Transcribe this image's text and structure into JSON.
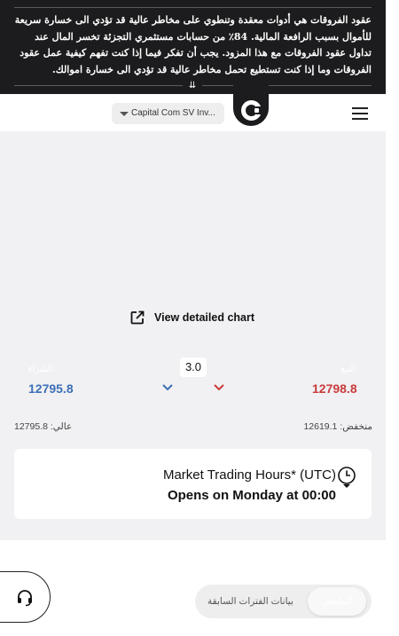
{
  "risk_banner": {
    "text": "عقود الفروقات هي أدوات معقدة وتنطوي على مخاطر عالية قد تؤدي الى خسارة سريعة للأموال بسبب الرافعة المالية. 84٪ من حسابات مستثمري التجزئة تخسر المال عند تداول عقود الفروقات مع هذا المزود. يجب أن تفكر فيما إذا كنت تفهم كيفية عمل عقود الفروقات وما إذا كنت تستطيع تحمل مخاطر عالية قد تؤدي الى خسارة اموالك.",
    "toggle_icon": "double-chevron-down"
  },
  "header": {
    "entity_selector": "Capital Com SV Inv...",
    "logo": "capital-com-logo",
    "menu_icon": "hamburger"
  },
  "chart": {
    "view_detailed_chart": "View detailed chart"
  },
  "quote": {
    "sell_label": "البيع",
    "sell_price": "12798.8",
    "buy_label": "الشراء",
    "buy_price": "12795.8",
    "spread": "3.0",
    "sell_color": "#c93b3b",
    "buy_color": "#3c6fb5"
  },
  "range": {
    "high": "عالي: 12795.8",
    "low": "منخفض: 12619.1"
  },
  "trading_hours": {
    "title": "Market Trading Hours* (UTC)",
    "status": "Opens on Monday at 00:00"
  },
  "bottom_tabs": {
    "summary": "الملخص",
    "previous_periods": "بيانات الفترات السابقة"
  }
}
